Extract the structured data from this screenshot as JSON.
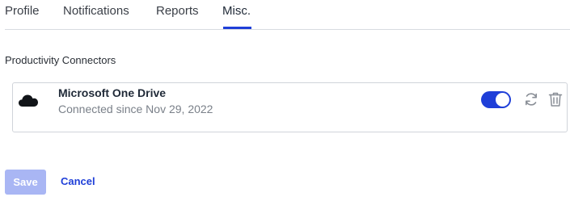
{
  "tabs": [
    {
      "label": "Profile"
    },
    {
      "label": "Notifications"
    },
    {
      "label": "Reports"
    },
    {
      "label": "Misc.",
      "active": true
    }
  ],
  "section": {
    "title": "Productivity Connectors"
  },
  "connectors": [
    {
      "name": "Microsoft One Drive",
      "status": "Connected since Nov 29, 2022",
      "icon": "cloud-icon",
      "enabled": true
    }
  ],
  "actions": {
    "refresh_icon": "refresh-icon",
    "delete_icon": "trash-icon"
  },
  "footer": {
    "save_label": "Save",
    "cancel_label": "Cancel"
  },
  "colors": {
    "accent": "#1f3fd8",
    "save_disabled": "#a9b6f4"
  }
}
